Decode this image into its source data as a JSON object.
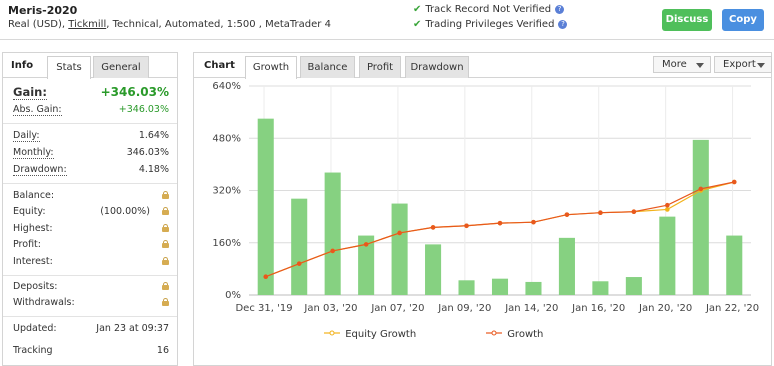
{
  "account": {
    "title": "Meris-2020",
    "sub_prefix": "Real (USD),",
    "broker": "Tickmill",
    "sub_suffix": ", Technical, Automated, 1:500 , MetaTrader 4"
  },
  "verification": [
    {
      "label": "Track Record Not Verified",
      "icon": "check-icon"
    },
    {
      "label": "Trading Privileges Verified",
      "icon": "check-icon"
    }
  ],
  "buttons": {
    "discuss": "Discuss",
    "copy": "Copy"
  },
  "left_tabs": {
    "heading": "Info",
    "stats": "Stats",
    "general": "General"
  },
  "stats": {
    "gain_label": "Gain:",
    "gain_value": "+346.03%",
    "abs_gain_label": "Abs. Gain:",
    "abs_gain_value": "+346.03%",
    "daily_label": "Daily:",
    "daily_value": "1.64%",
    "monthly_label": "Monthly:",
    "monthly_value": "346.03%",
    "drawdown_label": "Drawdown:",
    "drawdown_value": "4.18%",
    "balance_label": "Balance:",
    "equity_label": "Equity:",
    "equity_value": "(100.00%)",
    "highest_label": "Highest:",
    "profit_label": "Profit:",
    "interest_label": "Interest:",
    "deposits_label": "Deposits:",
    "withdrawals_label": "Withdrawals:",
    "updated_label": "Updated:",
    "updated_value": "Jan 23 at 09:37",
    "tracking_label": "Tracking",
    "tracking_value": "16"
  },
  "chart_tabs": {
    "heading": "Chart",
    "growth": "Growth",
    "balance": "Balance",
    "profit": "Profit",
    "drawdown": "Drawdown",
    "more": "More",
    "export": "Export"
  },
  "colors": {
    "bar": "#86d181",
    "growth": "#e8581e",
    "equity": "#f2b21a",
    "grid": "#dcdcdc"
  },
  "chart_data": {
    "type": "bar",
    "ylim": [
      0,
      640
    ],
    "y_ticks": [
      "0%",
      "160%",
      "320%",
      "480%",
      "640%"
    ],
    "y_tick_values": [
      0,
      160,
      320,
      480,
      640
    ],
    "x_tick_labels": [
      "Dec 31, '19",
      "Jan 03, '20",
      "Jan 07, '20",
      "Jan 09, '20",
      "Jan 14, '20",
      "Jan 16, '20",
      "Jan 20, '20",
      "Jan 22, '20"
    ],
    "bars": [
      540,
      295,
      375,
      182,
      280,
      155,
      45,
      50,
      40,
      175,
      42,
      55,
      240,
      475,
      182
    ],
    "series": [
      {
        "name": "Equity Growth",
        "values": [
          56,
          96,
          135,
          155,
          190,
          207,
          212,
          220,
          223,
          246,
          252,
          255,
          262,
          320,
          346
        ]
      },
      {
        "name": "Growth",
        "values": [
          56,
          96,
          135,
          155,
          190,
          207,
          212,
          220,
          223,
          246,
          252,
          255,
          275,
          325,
          346
        ]
      }
    ],
    "legend_position": "bottom"
  }
}
